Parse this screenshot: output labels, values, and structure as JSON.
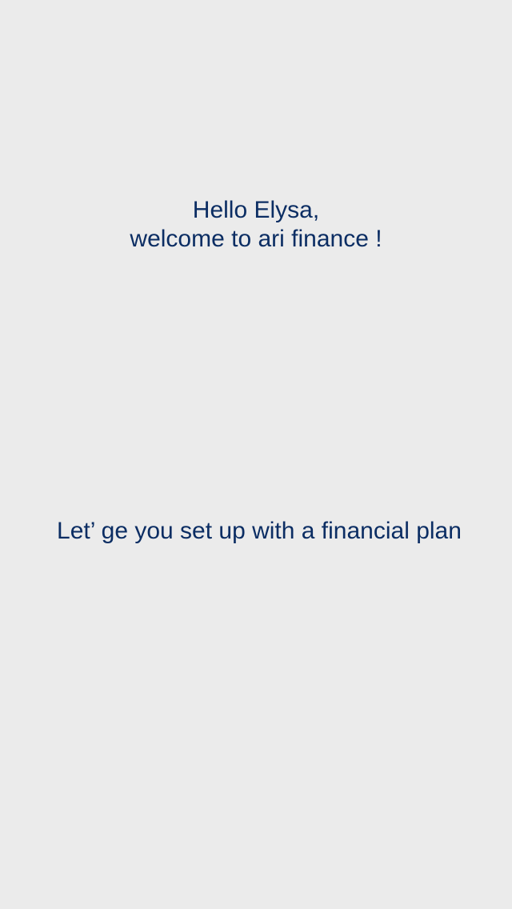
{
  "welcome": {
    "greeting_line": "Hello Elysa,",
    "welcome_line": "welcome to ari finance !"
  },
  "onboarding": {
    "message": "Let’ ge you set up with a financial plan"
  },
  "colors": {
    "background": "#ebebeb",
    "text": "#0b2d63"
  }
}
